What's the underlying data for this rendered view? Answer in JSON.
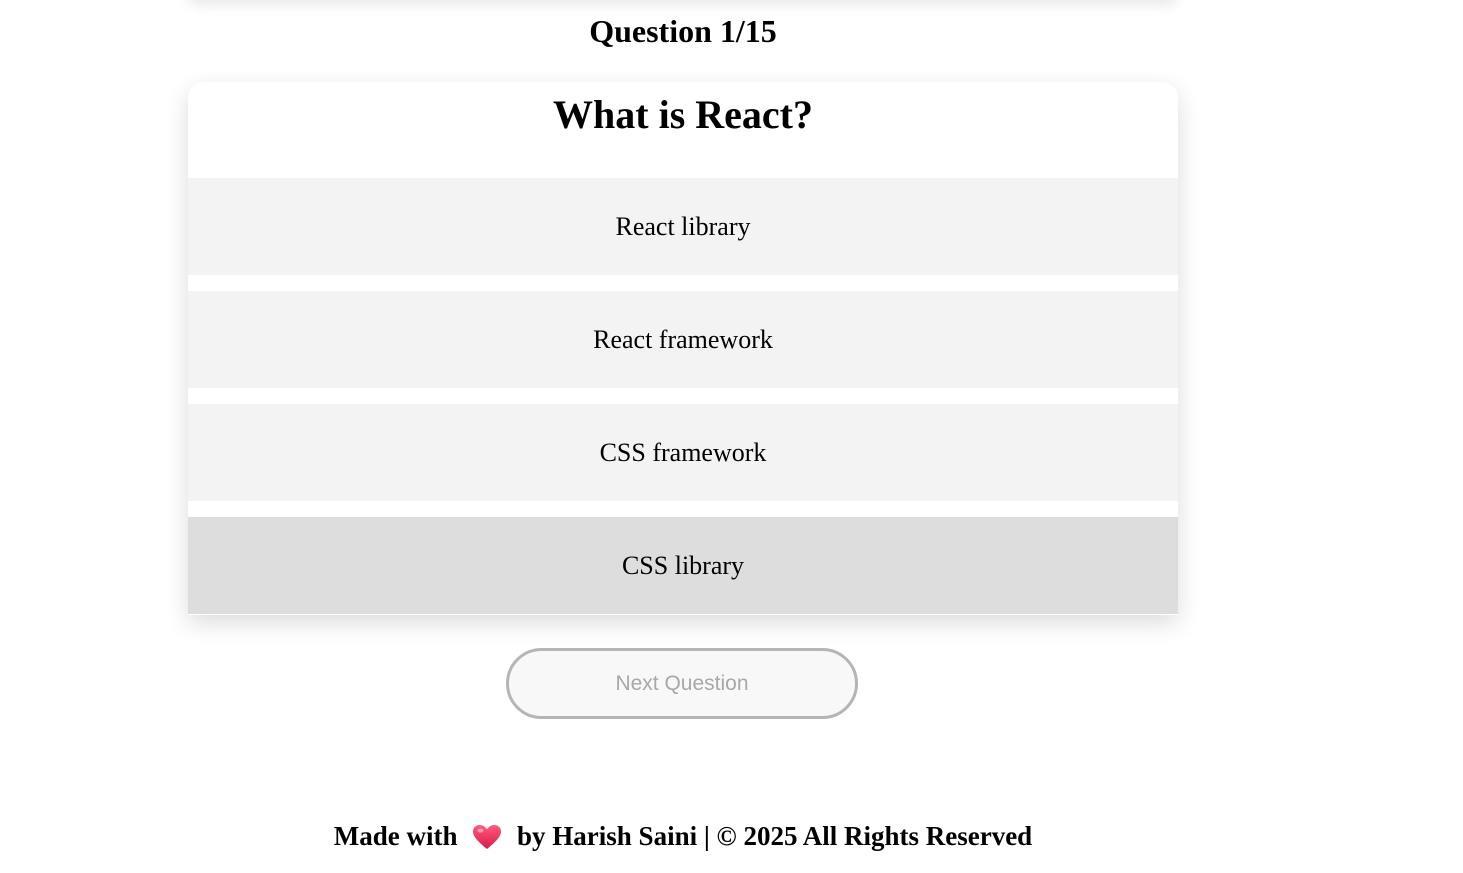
{
  "quiz": {
    "counter": "Question 1/15",
    "question": "What is React?",
    "options": [
      "React library",
      "React framework",
      "CSS framework",
      "CSS library"
    ],
    "next_label": "Next Question"
  },
  "footer": {
    "prefix": "Made with",
    "icon": "heart-icon",
    "suffix": "by Harish Saini | © 2025 All Rights Reserved"
  },
  "colors": {
    "option_bg": "#f3f3f3",
    "option_hover_bg": "#dddddd",
    "heart": "#e8335a",
    "button_border": "#b5b5b5",
    "button_text": "#a8a8a8"
  }
}
